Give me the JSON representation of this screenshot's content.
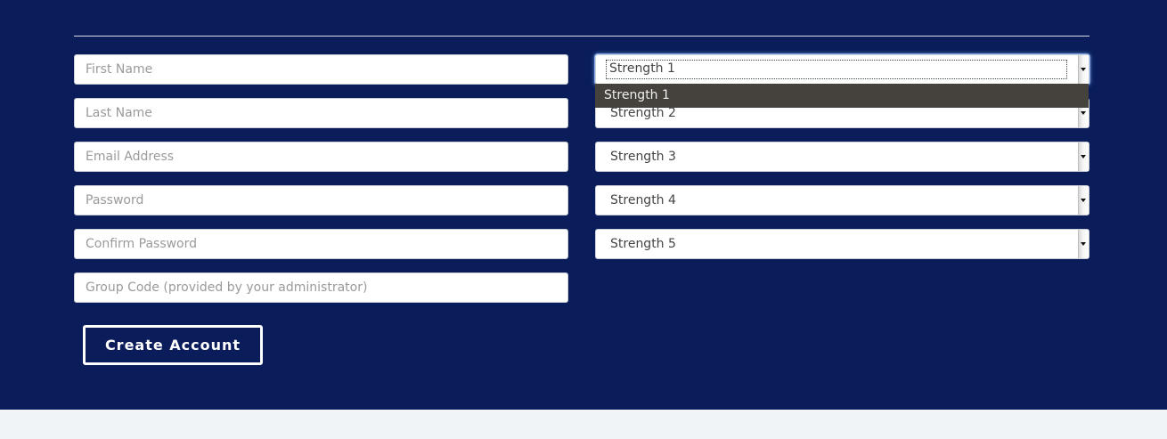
{
  "form": {
    "fields": [
      {
        "placeholder": "First Name"
      },
      {
        "placeholder": "Last Name"
      },
      {
        "placeholder": "Email Address"
      },
      {
        "placeholder": "Password"
      },
      {
        "placeholder": "Confirm Password"
      },
      {
        "placeholder": "Group Code (provided by your administrator)"
      }
    ],
    "strengths": [
      {
        "value": "Strength 1"
      },
      {
        "value": "Strength 2"
      },
      {
        "value": "Strength 3"
      },
      {
        "value": "Strength 4"
      },
      {
        "value": "Strength 5"
      }
    ],
    "dropdown_option": "Strength 1",
    "submit_label": "Create Account"
  },
  "colors": {
    "background": "#0a1d5a",
    "footer": "#f1f4f6",
    "dropdown_bg": "#45423d"
  }
}
